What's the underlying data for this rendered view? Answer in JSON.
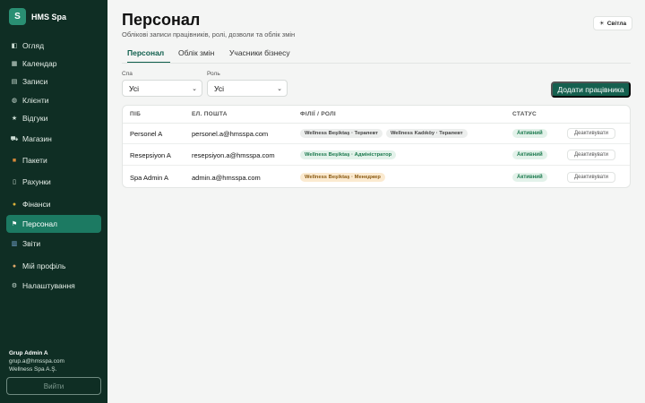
{
  "brand": {
    "logo_letter": "S",
    "name": "HMS Spa"
  },
  "sidebar": {
    "items": [
      {
        "label": "Огляд",
        "icon": "overview-icon"
      },
      {
        "label": "Календар",
        "icon": "calendar-icon"
      },
      {
        "label": "Записи",
        "icon": "appointments-icon"
      },
      {
        "label": "Клієнти",
        "icon": "clients-icon"
      },
      {
        "label": "Відгуки",
        "icon": "star-icon"
      },
      {
        "label": "Магазин",
        "icon": "cart-icon"
      },
      {
        "label": "Пакети",
        "icon": "package-icon"
      },
      {
        "label": "Рахунки",
        "icon": "invoice-icon"
      },
      {
        "label": "Фінанси",
        "icon": "money-bag-icon"
      },
      {
        "label": "Персонал",
        "icon": "flag-icon",
        "active": true
      },
      {
        "label": "Звіти",
        "icon": "chart-icon"
      },
      {
        "label": "Мій профіль",
        "icon": "user-icon"
      },
      {
        "label": "Налаштування",
        "icon": "gear-icon"
      }
    ],
    "user": {
      "name": "Grup Admin A",
      "email": "grup.a@hmsspa.com",
      "company": "Wellness Spa A.Ş."
    },
    "logout_label": "Вийти"
  },
  "header": {
    "title": "Персонал",
    "subtitle": "Облікові записи працівників, ролі, дозволи та облік змін",
    "theme_label": "Світла",
    "theme_icon": "sun-icon"
  },
  "tabs": [
    {
      "label": "Персонал",
      "active": true
    },
    {
      "label": "Облік змін",
      "active": false
    },
    {
      "label": "Учасники бізнесу",
      "active": false
    }
  ],
  "filters": {
    "spa": {
      "label": "Спа",
      "value": "Усі"
    },
    "role": {
      "label": "Роль",
      "value": "Усі"
    }
  },
  "add_button_label": "Додати працівника",
  "table": {
    "headers": [
      "ПІБ",
      "ЕЛ. ПОШТА",
      "ФІЛІЇ / РОЛІ",
      "СТАТУС"
    ],
    "rows": [
      {
        "name": "Personel A",
        "email": "personel.a@hmsspa.com",
        "roles": [
          {
            "text": "Wellness Beşiktaş · Терапевт",
            "style": "grey"
          },
          {
            "text": "Wellness Kadıköy · Терапевт",
            "style": "grey"
          }
        ],
        "status": "Активний",
        "action": "Деактивувати"
      },
      {
        "name": "Resepsiyon A",
        "email": "resepsiyon.a@hmsspa.com",
        "roles": [
          {
            "text": "Wellness Beşiktaş · Адміністратор",
            "style": "green"
          }
        ],
        "status": "Активний",
        "action": "Деактивувати"
      },
      {
        "name": "Spa Admin A",
        "email": "admin.a@hmsspa.com",
        "roles": [
          {
            "text": "Wellness Beşiktaş · Менеджер",
            "style": "orange"
          }
        ],
        "status": "Активний",
        "action": "Деактивувати"
      }
    ]
  },
  "colors": {
    "sidebar_bg": "#0f2e24",
    "accent": "#15604f",
    "active_nav": "#1c7a62",
    "status_green": "#1c7a4e"
  }
}
